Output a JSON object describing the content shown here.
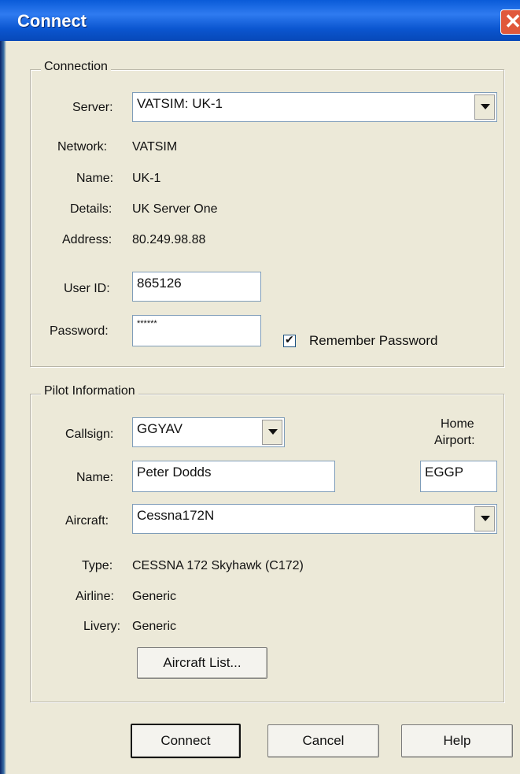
{
  "window": {
    "title": "Connect",
    "close_icon": "close-icon"
  },
  "connection": {
    "legend": "Connection",
    "server_label": "Server:",
    "server_value": "VATSIM: UK-1",
    "network_label": "Network:",
    "network_value": "VATSIM",
    "name_label": "Name:",
    "name_value": "UK-1",
    "details_label": "Details:",
    "details_value": "UK Server One",
    "address_label": "Address:",
    "address_value": "80.249.98.88",
    "userid_label": "User ID:",
    "userid_value": "865126",
    "password_label": "Password:",
    "password_value": "******",
    "remember_label": "Remember Password",
    "remember_checked": true
  },
  "pilot": {
    "legend": "Pilot Information",
    "callsign_label": "Callsign:",
    "callsign_value": "GGYAV",
    "home_label_1": "Home",
    "home_label_2": "Airport:",
    "home_value": "EGGP",
    "name_label": "Name:",
    "name_value": "Peter Dodds",
    "aircraft_label": "Aircraft:",
    "aircraft_value": "Cessna172N",
    "type_label": "Type:",
    "type_value": "CESSNA 172 Skyhawk (C172)",
    "airline_label": "Airline:",
    "airline_value": "Generic",
    "livery_label": "Livery:",
    "livery_value": "Generic",
    "aircraft_list_button": "Aircraft List..."
  },
  "buttons": {
    "connect": "Connect",
    "cancel": "Cancel",
    "help": "Help"
  }
}
